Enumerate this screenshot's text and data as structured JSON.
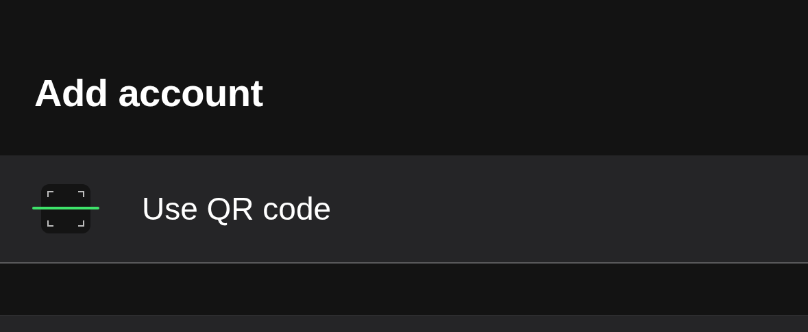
{
  "title": "Add account",
  "options": [
    {
      "kind": "qr",
      "label": "Use QR code"
    },
    {
      "kind": "blank"
    }
  ]
}
